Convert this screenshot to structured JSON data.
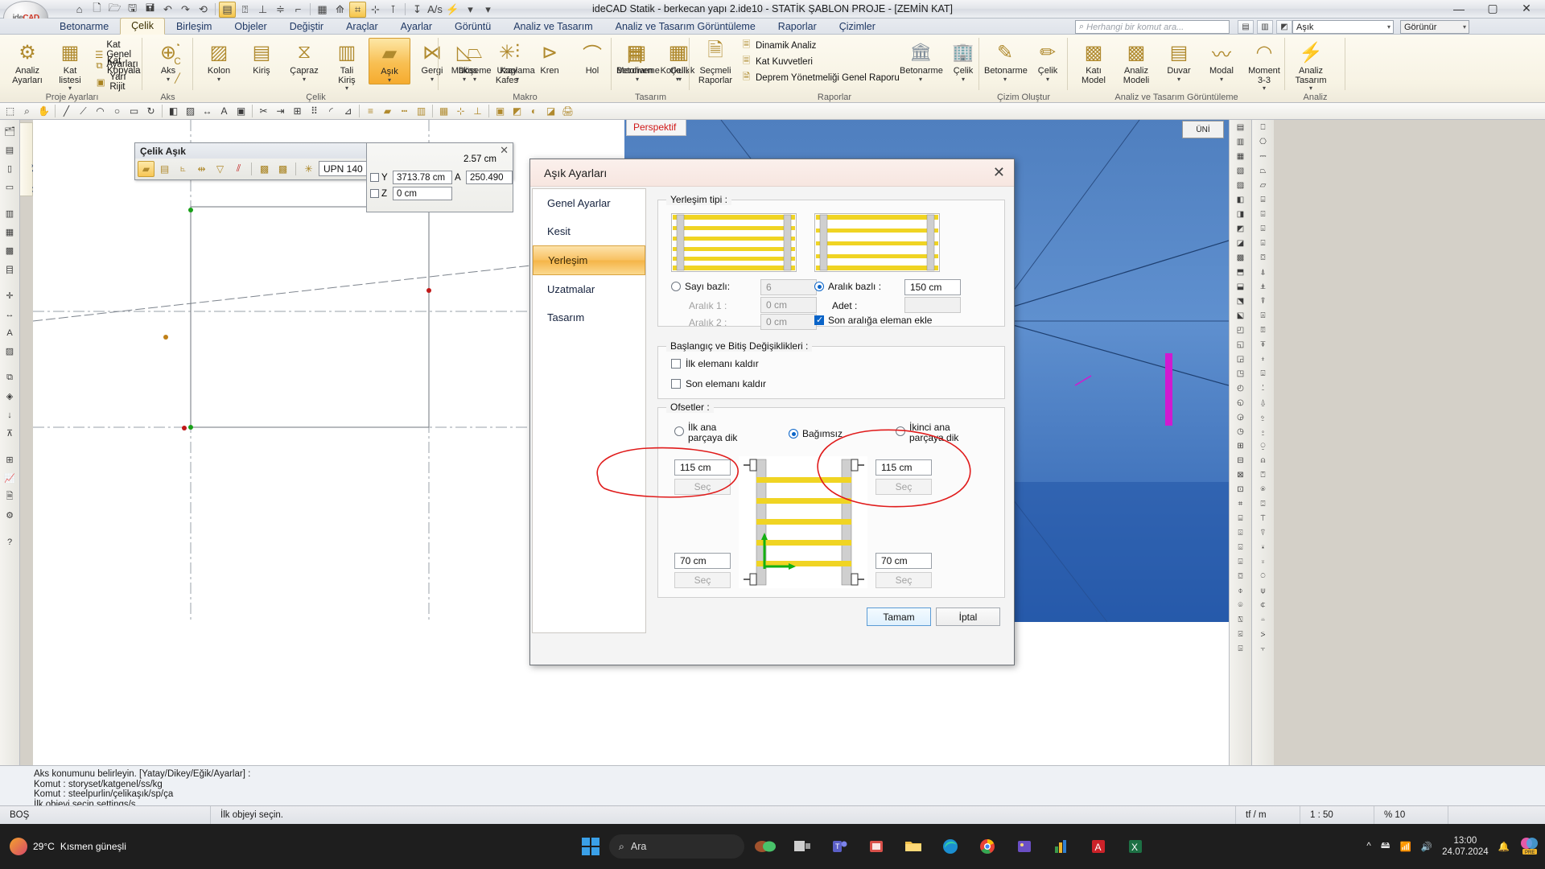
{
  "window": {
    "title": "ideCAD Statik - berkecan yapı 2.ide10 - STATİK ŞABLON PROJE - [ZEMİN KAT]",
    "minimize": "—",
    "maximize": "▢",
    "close": "✕",
    "logo_ide": "ide",
    "logo_cad": "CAD"
  },
  "quick_access": {
    "items": [
      {
        "name": "home-icon",
        "glyph": "⌂"
      },
      {
        "name": "new-file-icon",
        "glyph": "🗋"
      },
      {
        "name": "open-folder-icon",
        "glyph": "🗁"
      },
      {
        "name": "save-icon",
        "glyph": "🖫"
      },
      {
        "name": "save-as-icon",
        "glyph": "🖬"
      },
      {
        "name": "undo-icon",
        "glyph": "↶"
      },
      {
        "name": "redo-icon",
        "glyph": "↷"
      },
      {
        "name": "refresh-icon",
        "glyph": "⟲"
      },
      {
        "name": "list-panel-icon",
        "glyph": "▤"
      },
      {
        "name": "pointer-icon",
        "glyph": "⍰"
      },
      {
        "name": "align-bottom-icon",
        "glyph": "⊥"
      },
      {
        "name": "distribute-icon",
        "glyph": "≑"
      },
      {
        "name": "corner-icon",
        "glyph": "⌐"
      },
      {
        "name": "grid-icon",
        "glyph": "▦"
      },
      {
        "name": "snap-icon",
        "glyph": "⟰"
      },
      {
        "name": "osnap-icon",
        "glyph": "⌗"
      },
      {
        "name": "perp-icon",
        "glyph": "⊹"
      },
      {
        "name": "perp2-icon",
        "glyph": "⊺"
      },
      {
        "name": "dim-icon",
        "glyph": "↧"
      },
      {
        "name": "text-icon",
        "glyph": "A/s"
      },
      {
        "name": "lightning-icon",
        "glyph": "⚡"
      },
      {
        "name": "qat-more-icon",
        "glyph": "▾"
      },
      {
        "name": "qat-overflow-icon",
        "glyph": "▾"
      }
    ]
  },
  "ribbon": {
    "tabs": [
      {
        "label": "Betonarme",
        "active": false
      },
      {
        "label": "Çelik",
        "active": true
      },
      {
        "label": "Birleşim",
        "active": false
      },
      {
        "label": "Objeler",
        "active": false
      },
      {
        "label": "Değiştir",
        "active": false
      },
      {
        "label": "Araçlar",
        "active": false
      },
      {
        "label": "Ayarlar",
        "active": false
      },
      {
        "label": "Görüntü",
        "active": false
      },
      {
        "label": "Analiz ve Tasarım",
        "active": false
      },
      {
        "label": "Analiz ve Tasarım Görüntüleme",
        "active": false
      },
      {
        "label": "Raporlar",
        "active": false
      },
      {
        "label": "Çizimler",
        "active": false
      }
    ],
    "search_placeholder": "Herhangi bir komut ara...",
    "object_combo": "Aşık",
    "view_combo": "Görünür",
    "groups": [
      {
        "title": "Proje Ayarları",
        "big": [
          {
            "label1": "Analiz",
            "label2": "Ayarları",
            "icon": "gear-icon",
            "glyph": "⚙"
          },
          {
            "label1": "Kat",
            "label2": "listesi",
            "icon": "floor-list-icon",
            "glyph": "▦",
            "caret": "▾"
          }
        ],
        "small": [
          {
            "label": "Kat Genel Ayarları",
            "icon": "floor-settings-icon",
            "glyph": "☰"
          },
          {
            "label": "Kat Kopyala",
            "icon": "copy-floor-icon",
            "glyph": "⧉"
          },
          {
            "label": "Yarı Rijit",
            "icon": "semi-rigid-icon",
            "glyph": "▣"
          }
        ]
      },
      {
        "title": "Aks",
        "big": [
          {
            "label1": "Aks",
            "label2": "",
            "icon": "axis-icon",
            "glyph": "⊕",
            "caret": "▾"
          }
        ],
        "small": [
          {
            "label": "",
            "icon": "axis-circular-icon",
            "glyph": "◔"
          },
          {
            "label": "",
            "icon": "axis-arc-icon",
            "glyph": "C"
          },
          {
            "label": "",
            "icon": "axis-line-icon",
            "glyph": "╱"
          }
        ]
      },
      {
        "title": "Çelik",
        "big": [
          {
            "label1": "Kolon",
            "label2": "",
            "icon": "column-icon",
            "glyph": "▨",
            "caret": "▾"
          },
          {
            "label1": "Kiriş",
            "label2": "",
            "icon": "beam-icon",
            "glyph": "▤"
          },
          {
            "label1": "Çapraz",
            "label2": "",
            "icon": "brace-icon",
            "glyph": "⧖",
            "caret": "▾"
          },
          {
            "label1": "Tali",
            "label2": "Kiriş",
            "icon": "secondary-beam-icon",
            "glyph": "▥",
            "caret": "▾"
          },
          {
            "label1": "Aşık",
            "label2": "",
            "icon": "purlin-icon",
            "glyph": "▰",
            "caret": "▾",
            "selected": true
          },
          {
            "label1": "Gergi",
            "label2": "",
            "icon": "tie-icon",
            "glyph": "⋈",
            "caret": "▾"
          },
          {
            "label1": "Döşeme",
            "label2": "",
            "icon": "slab-icon",
            "glyph": "⏢",
            "caret": "▾"
          },
          {
            "label1": "Kaplama",
            "label2": "",
            "icon": "cladding-icon",
            "glyph": "⫶",
            "caret": "▾"
          }
        ]
      },
      {
        "title": "Makro",
        "big": [
          {
            "label1": "Makas",
            "label2": "",
            "icon": "truss-icon",
            "glyph": "◺",
            "caret": "▾"
          },
          {
            "label1": "Uzay",
            "label2": "Kafes",
            "icon": "space-frame-icon",
            "glyph": "✳"
          },
          {
            "label1": "Kren",
            "label2": "",
            "icon": "crane-icon",
            "glyph": "⊳"
          },
          {
            "label1": "Hol",
            "label2": "",
            "icon": "hall-icon",
            "glyph": "⌒"
          },
          {
            "label1": "Merdiven",
            "label2": "",
            "icon": "stairs-icon",
            "glyph": "目"
          },
          {
            "label1": "Korkuluk",
            "label2": "",
            "icon": "railing-icon",
            "glyph": "▦",
            "caret": "▾"
          }
        ]
      },
      {
        "title": "Tasarım",
        "big": [
          {
            "label1": "Betonarme",
            "label2": "",
            "icon": "rc-design-icon",
            "glyph": "▦",
            "caret": "▾"
          },
          {
            "label1": "Çelik",
            "label2": "",
            "icon": "steel-design-icon",
            "glyph": "▥",
            "caret": "▾"
          }
        ]
      },
      {
        "title": "Raporlar",
        "big": [
          {
            "label1": "Seçmeli",
            "label2": "Raporlar",
            "icon": "selective-reports-icon",
            "glyph": "🗎"
          }
        ],
        "small": [
          {
            "label": "Dinamik Analiz",
            "icon": "dynamic-analysis-icon",
            "glyph": "🗏"
          },
          {
            "label": "Kat Kuvvetleri",
            "icon": "floor-forces-icon",
            "glyph": "🗏"
          },
          {
            "label": "Deprem Yönetmeliği Genel Raporu",
            "icon": "earthquake-report-icon",
            "glyph": "🗎"
          }
        ],
        "big2": [
          {
            "label1": "Betonarme",
            "label2": "",
            "icon": "rc-report-icon",
            "glyph": "🏛",
            "caret": "▾"
          },
          {
            "label1": "Çelik",
            "label2": "",
            "icon": "steel-report-icon",
            "glyph": "🏢",
            "caret": "▾"
          }
        ]
      },
      {
        "title": "Çizim Oluştur",
        "big": [
          {
            "label1": "Betonarme",
            "label2": "",
            "icon": "rc-drawing-icon",
            "glyph": "✎",
            "caret": "▾"
          },
          {
            "label1": "Çelik",
            "label2": "",
            "icon": "steel-drawing-icon",
            "glyph": "✏",
            "caret": "▾"
          }
        ]
      },
      {
        "title": "Analiz ve Tasarım Görüntüleme",
        "big": [
          {
            "label1": "Katı",
            "label2": "Model",
            "icon": "solid-model-icon",
            "glyph": "▩"
          },
          {
            "label1": "Analiz",
            "label2": "Modeli",
            "icon": "analysis-model-icon",
            "glyph": "▩"
          },
          {
            "label1": "Duvar",
            "label2": "",
            "icon": "wall-icon",
            "glyph": "▤",
            "caret": "▾"
          },
          {
            "label1": "Modal",
            "label2": "",
            "icon": "modal-icon",
            "glyph": "〰",
            "caret": "▾"
          },
          {
            "label1": "Moment",
            "label2": "3-3",
            "icon": "moment-icon",
            "glyph": "◠",
            "caret": "▾"
          }
        ]
      },
      {
        "title": "Analiz",
        "big": [
          {
            "label1": "Analiz",
            "label2": "Tasarım",
            "icon": "run-analysis-icon",
            "glyph": "⚡",
            "caret": "▾"
          }
        ]
      }
    ]
  },
  "cad_toolbar": {
    "items": [
      {
        "name": "select-icon",
        "glyph": "⬚"
      },
      {
        "name": "zoom-window-icon",
        "glyph": "⌕"
      },
      {
        "name": "pan-icon",
        "glyph": "✋"
      },
      {
        "name": "line-icon",
        "glyph": "╱"
      },
      {
        "name": "polyline-icon",
        "glyph": "⟋"
      },
      {
        "name": "arc-icon",
        "glyph": "◠"
      },
      {
        "name": "circle-icon",
        "glyph": "○"
      },
      {
        "name": "rect-icon",
        "glyph": "▭"
      },
      {
        "name": "rotate-icon",
        "glyph": "↻"
      },
      {
        "name": "mirror-icon",
        "glyph": "◧"
      },
      {
        "name": "hatch-icon",
        "glyph": "▨"
      },
      {
        "name": "dimension-icon",
        "glyph": "↔"
      },
      {
        "name": "text-tool-icon",
        "glyph": "A"
      },
      {
        "name": "block-icon",
        "glyph": "▣"
      },
      {
        "name": "trim-icon",
        "glyph": "✂"
      },
      {
        "name": "extend-icon",
        "glyph": "⇥"
      },
      {
        "name": "offset-icon",
        "glyph": "⊞"
      },
      {
        "name": "array-icon",
        "glyph": "⠿"
      },
      {
        "name": "fillet-icon",
        "glyph": "◜"
      },
      {
        "name": "measure-icon",
        "glyph": "⊿"
      },
      {
        "name": "layer-icon",
        "glyph": "≡"
      },
      {
        "name": "color-icon",
        "glyph": "▰"
      },
      {
        "name": "linetype-icon",
        "glyph": "┅"
      },
      {
        "name": "properties-icon",
        "glyph": "▥"
      },
      {
        "name": "grid-toggle-icon",
        "glyph": "▦"
      },
      {
        "name": "snap-toggle-icon",
        "glyph": "⊹"
      },
      {
        "name": "ortho-icon",
        "glyph": "⊥"
      },
      {
        "name": "view-top-icon",
        "glyph": "▣"
      },
      {
        "name": "view-3d-icon",
        "glyph": "◩"
      },
      {
        "name": "render-icon",
        "glyph": "◐"
      },
      {
        "name": "section-icon",
        "glyph": "◪"
      },
      {
        "name": "plot-icon",
        "glyph": "🖨"
      }
    ]
  },
  "left_toolbar": {
    "dock_label": "Yapı Ağacı",
    "items": [
      {
        "name": "tree-icon",
        "glyph": "🗂"
      },
      {
        "name": "layers-icon",
        "glyph": "▤"
      },
      {
        "name": "column-tool-icon",
        "glyph": "▯"
      },
      {
        "name": "beam-tool-icon",
        "glyph": "▭"
      },
      {
        "name": "wall-tool-icon",
        "glyph": "▥"
      },
      {
        "name": "slab-tool-icon",
        "glyph": "▦"
      },
      {
        "name": "foundation-icon",
        "glyph": "▩"
      },
      {
        "name": "stair-tool-icon",
        "glyph": "目"
      },
      {
        "name": "axis-tool-icon",
        "glyph": "✛"
      },
      {
        "name": "dim-tool-icon",
        "glyph": "↔"
      },
      {
        "name": "text-tool2-icon",
        "glyph": "A"
      },
      {
        "name": "hatch-tool-icon",
        "glyph": "▨"
      },
      {
        "name": "group-icon",
        "glyph": "⧉"
      },
      {
        "name": "node-icon",
        "glyph": "◈"
      },
      {
        "name": "load-icon",
        "glyph": "↓"
      },
      {
        "name": "support-icon",
        "glyph": "⊼"
      },
      {
        "name": "mesh-icon",
        "glyph": "⊞"
      },
      {
        "name": "result-icon",
        "glyph": "📈"
      },
      {
        "name": "report-tool-icon",
        "glyph": "🗎"
      },
      {
        "name": "settings-tool-icon",
        "glyph": "⚙"
      },
      {
        "name": "help-tool-icon",
        "glyph": "?"
      }
    ]
  },
  "right_palette": {
    "col1": [
      "▤",
      "▥",
      "▦",
      "▧",
      "▨",
      "◧",
      "◨",
      "◩",
      "◪",
      "▩",
      "⬒",
      "⬓",
      "⬔",
      "⬕",
      "◰",
      "◱",
      "◲",
      "◳",
      "◴",
      "◵",
      "◶",
      "◷",
      "⊞",
      "⊟",
      "⊠",
      "⊡",
      "⌗",
      "⌸",
      "⌹",
      "⌺",
      "⌻",
      "⌼",
      "⌽",
      "⌾",
      "⍂",
      "⍃",
      "⍄"
    ],
    "col2": [
      "⎕",
      "⎔",
      "⎓",
      "⏢",
      "⏥",
      "⌸",
      "⌹",
      "⌺",
      "⌻",
      "⌼",
      "⍋",
      "⍎",
      "⍒",
      "⍓",
      "⍔",
      "⍕",
      "⍖",
      "⍗",
      "⍘",
      "⍙",
      "⍚",
      "⍛",
      "⍜",
      "⍝",
      "⍞",
      "⍟",
      "⍠",
      "⍡",
      "⍢",
      "⍣",
      "⍤",
      "⍥",
      "⍦",
      "⍧",
      "⍨",
      "⍩",
      "⍪"
    ]
  },
  "viewport": {
    "perspective_tab": "Perspektif",
    "viewcube": "ÜNİ"
  },
  "float_toolbar": {
    "title": "Çelik Aşık",
    "close": "✕",
    "buttons": [
      {
        "name": "purlin-single-icon",
        "glyph": "▰",
        "selected": true
      },
      {
        "name": "purlin-multi-icon",
        "glyph": "▤",
        "selected": false
      },
      {
        "name": "purlin-angle-icon",
        "glyph": "⦜",
        "selected": false
      },
      {
        "name": "purlin-span-icon",
        "glyph": "⇹",
        "selected": false
      },
      {
        "name": "purlin-taper-icon",
        "glyph": "▽",
        "selected": false
      },
      {
        "name": "purlin-parallel-icon",
        "glyph": "⫽",
        "selected": false
      },
      {
        "name": "purlin-grid1-icon",
        "glyph": "▩",
        "selected": false
      },
      {
        "name": "purlin-grid2-icon",
        "glyph": "▩",
        "selected": false
      },
      {
        "name": "purlin-snap-icon",
        "glyph": "✳",
        "selected": false
      }
    ],
    "section_value": "UPN 140",
    "settings_icon": "gear-settings-icon"
  },
  "coord_panel": {
    "close": "✕",
    "section_len": "2.57 cm",
    "rows": [
      {
        "axis": "Y",
        "value": "3713.78 cm",
        "extra_label": "A",
        "extra_value": "250.490"
      },
      {
        "axis": "Z",
        "value": "0 cm",
        "extra_label": "",
        "extra_value": ""
      }
    ]
  },
  "dialog": {
    "title": "Aşık Ayarları",
    "close": "✕",
    "sidebar": [
      {
        "label": "Genel Ayarlar",
        "active": false
      },
      {
        "label": "Kesit",
        "active": false
      },
      {
        "label": "Yerleşim",
        "active": true
      },
      {
        "label": "Uzatmalar",
        "active": false
      },
      {
        "label": "Tasarım",
        "active": false
      }
    ],
    "placement": {
      "group_label": "Yerleşim tipi :",
      "count_based": {
        "label": "Sayı bazlı:",
        "value": "6",
        "selected": false
      },
      "interval1": {
        "label": "Aralık 1 :",
        "value": "0 cm",
        "disabled": true
      },
      "interval2": {
        "label": "Aralık 2 :",
        "value": "0 cm",
        "disabled": true
      },
      "spacing_based": {
        "label": "Aralık bazlı :",
        "value": "150 cm",
        "selected": true
      },
      "count": {
        "label": "Adet :",
        "value": "",
        "disabled": true
      },
      "add_last": {
        "label": "Son aralığa eleman ekle",
        "checked": true
      }
    },
    "start_end": {
      "group_label": "Başlangıç ve Bitiş Değişiklikleri :",
      "remove_first": {
        "label": "İlk elemanı kaldır",
        "checked": false
      },
      "remove_last": {
        "label": "Son elemanı kaldır",
        "checked": false
      }
    },
    "offsets": {
      "group_label": "Ofsetler :",
      "first_perp": {
        "label1": "İlk ana",
        "label2": "parçaya dik",
        "selected": false
      },
      "independent": {
        "label": "Bağımsız",
        "selected": true
      },
      "second_perp": {
        "label1": "İkinci ana",
        "label2": "parçaya dik",
        "selected": false
      },
      "top_left": {
        "value": "115 cm",
        "button": "Seç"
      },
      "top_right": {
        "value": "115 cm",
        "button": "Seç"
      },
      "bottom_left": {
        "value": "70 cm",
        "button": "Seç"
      },
      "bottom_right": {
        "value": "70 cm",
        "button": "Seç"
      }
    },
    "buttons": {
      "ok": "Tamam",
      "cancel": "İptal"
    }
  },
  "command_area": {
    "lines": [
      "Aks konumunu belirleyin. [Yatay/Dikey/Eğik/Ayarlar] :",
      "Komut : storyset/katgenel/ss/kg",
      "Komut : steelpurlin/çelikaşık/sp/ça",
      "İlk objeyi seçin.settings/s"
    ]
  },
  "status_bar": {
    "left": "BOŞ",
    "prompt": "İlk objeyi seçin.",
    "unit": "tf / m",
    "scale": "1 : 50",
    "zoom": "% 10"
  },
  "taskbar": {
    "weather_temp": "29°C",
    "weather_desc": "Kısmen güneşli",
    "search_placeholder": "Ara",
    "apps": [
      {
        "name": "start-icon",
        "glyph": "⊞"
      },
      {
        "name": "copilot-icon",
        "glyph": "◉"
      },
      {
        "name": "task-view-icon",
        "glyph": "▢"
      },
      {
        "name": "teams-icon",
        "glyph": "T"
      },
      {
        "name": "store-icon",
        "glyph": "▤"
      },
      {
        "name": "explorer-icon",
        "glyph": "🗂"
      },
      {
        "name": "edge-icon",
        "glyph": "◯"
      },
      {
        "name": "chrome-icon",
        "glyph": "◉"
      },
      {
        "name": "photos-icon",
        "glyph": "▣"
      },
      {
        "name": "idecad-icon",
        "glyph": "▥"
      },
      {
        "name": "autocad-icon",
        "glyph": "A"
      },
      {
        "name": "excel-icon",
        "glyph": "X"
      }
    ],
    "tray": [
      {
        "name": "tray-expand-icon",
        "glyph": "^"
      },
      {
        "name": "usb-icon",
        "glyph": "🖴"
      },
      {
        "name": "wifi-icon",
        "glyph": "📶"
      },
      {
        "name": "volume-icon",
        "glyph": "🔊"
      }
    ],
    "time": "13:00",
    "date": "24.07.2024",
    "notification_icon": "bell-icon",
    "copilot_label": "PRE"
  }
}
